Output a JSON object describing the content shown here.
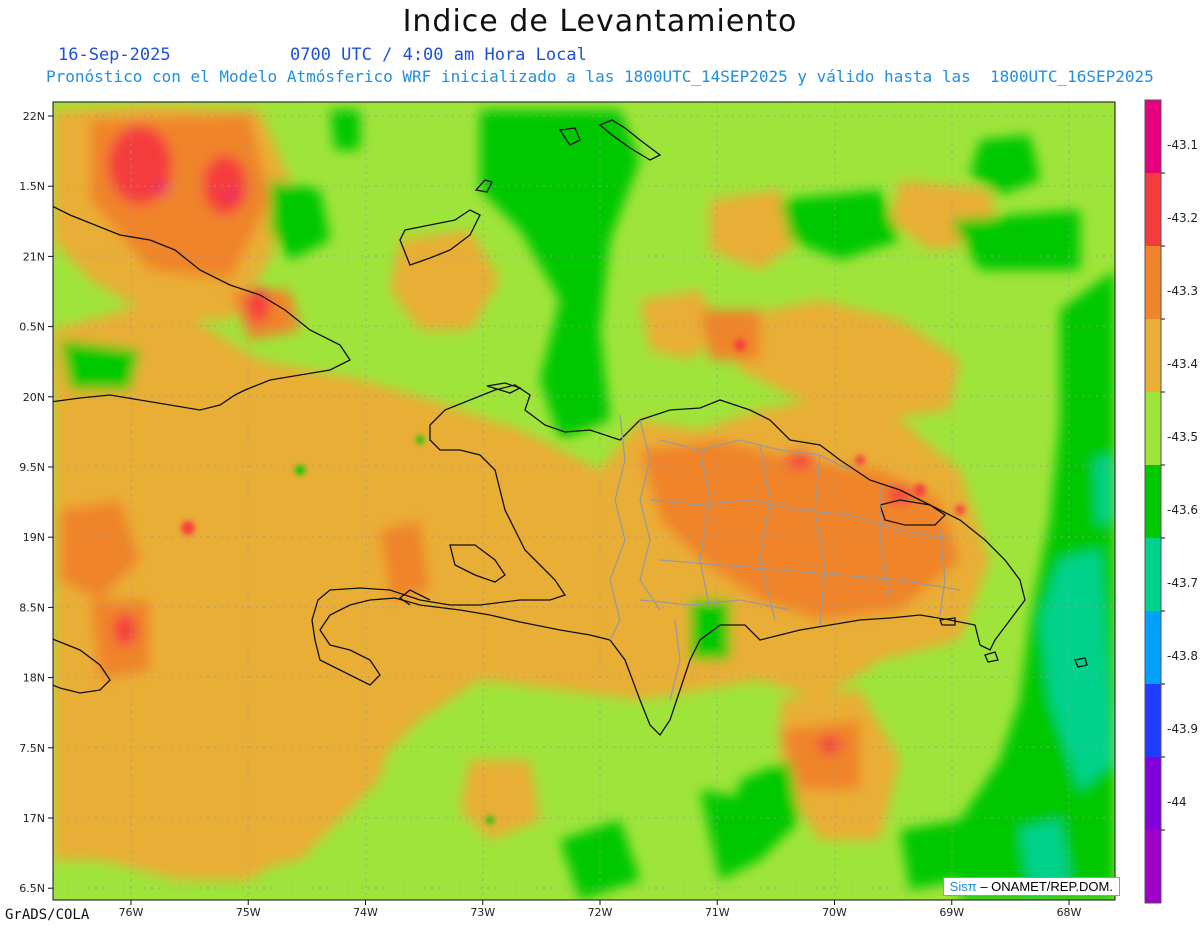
{
  "title": "Indice de Levantamiento",
  "date": "16-Sep-2025",
  "time": "0700 UTC / 4:00 am Hora Local",
  "description": "Pronóstico con el Modelo Atmósferico WRF inicializado a las 1800UTC_14SEP2025 y válido hasta las  1800UTC_16SEP2025",
  "lat_labels": [
    "22N",
    "1.5N",
    "21N",
    "0.5N",
    "20N",
    "9.5N",
    "19N",
    "8.5N",
    "18N",
    "7.5N",
    "17N",
    "6.5N"
  ],
  "lon_labels": [
    "76W",
    "75W",
    "74W",
    "73W",
    "72W",
    "71W",
    "70W",
    "69W",
    "68W"
  ],
  "colorbar": {
    "labels": [
      "-43.1",
      "-43.2",
      "-43.3",
      "-43.4",
      "-43.5",
      "-43.6",
      "-43.7",
      "-43.8",
      "-43.9",
      "-44"
    ],
    "colors": [
      "#e6007e",
      "#f53c3c",
      "#f0842c",
      "#e9ae34",
      "#9fe43a",
      "#00c800",
      "#00d28c",
      "#00a0ff",
      "#1e3cff",
      "#8200dc",
      "#a000c8"
    ]
  },
  "credit": {
    "sis": "Sisπ",
    "org": " – ONAMET/REP.DOM."
  },
  "footer": "GrADS/COLA"
}
